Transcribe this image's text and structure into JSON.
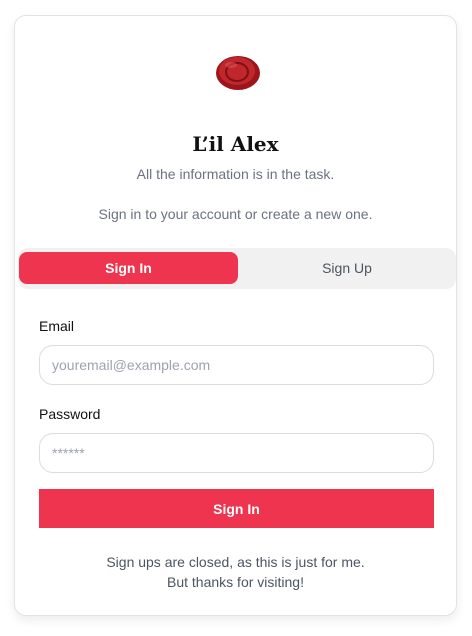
{
  "brand": {
    "name": "L’il Alex",
    "logo_icon": "wax-seal-icon",
    "logo_color": "#b01e23"
  },
  "subtitle": "All the information is in the task.",
  "hint": "Sign in to your account or create a new one.",
  "tabs": [
    {
      "label": "Sign In",
      "active": true
    },
    {
      "label": "Sign Up",
      "active": false
    }
  ],
  "form": {
    "email_label": "Email",
    "email_placeholder": "youremail@example.com",
    "email_value": "",
    "password_label": "Password",
    "password_placeholder": "******",
    "password_value": "",
    "submit_label": "Sign In"
  },
  "footer": {
    "line1": "Sign ups are closed, as this is just for me.",
    "line2": "But thanks for visiting!"
  },
  "colors": {
    "accent": "#ef3450"
  }
}
